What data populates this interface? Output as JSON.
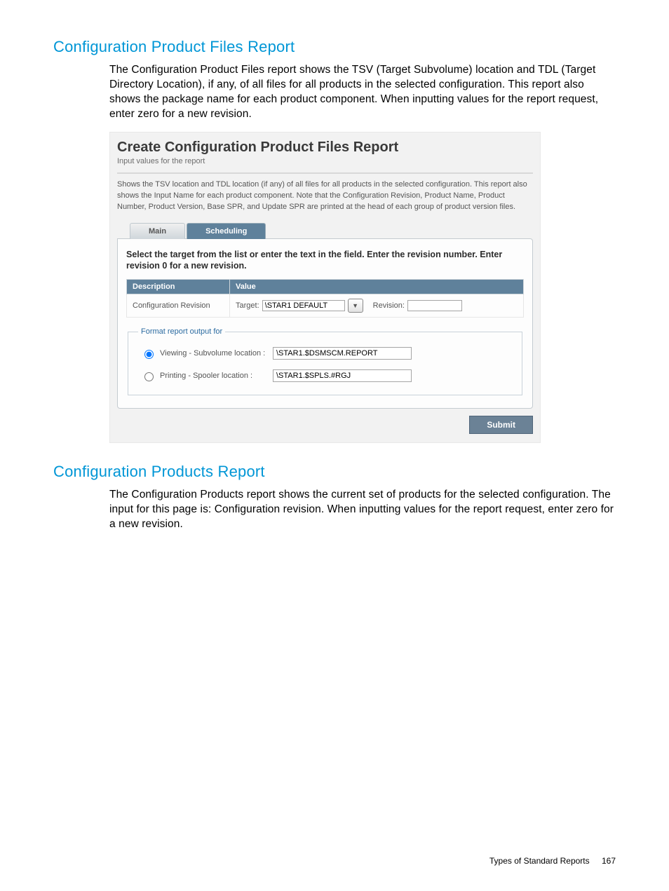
{
  "section1": {
    "heading": "Configuration Product Files Report",
    "paragraph": "The Configuration Product Files report shows the TSV (Target Subvolume) location and TDL (Target Directory Location), if any, of all files for all products in the selected configuration. This report also shows the package name for each product component. When inputting values for the report request, enter zero for a new revision."
  },
  "panel": {
    "title": "Create Configuration Product Files Report",
    "subtitle": "Input values for the report",
    "description": "Shows the TSV location and TDL location (if any) of all files for all products in the selected configuration. This report also shows the Input Name for each product component. Note that the Configuration Revision, Product Name, Product Number, Product Version, Base SPR, and Update SPR are printed at the head of each group of product version files.",
    "tabs": {
      "main": "Main",
      "scheduling": "Scheduling"
    },
    "instruction": "Select the target from the list or enter the text in the field. Enter the revision number. Enter revision 0 for a new revision.",
    "table": {
      "head_desc": "Description",
      "head_value": "Value",
      "row_desc": "Configuration Revision",
      "target_label": "Target:",
      "target_value": "\\STAR1 DEFAULT",
      "revision_label": "Revision:",
      "revision_value": ""
    },
    "format": {
      "legend": "Format report output for",
      "viewing_label": "Viewing - Subvolume location :",
      "viewing_value": "\\STAR1.$DSMSCM.REPORT",
      "printing_label": "Printing - Spooler location :",
      "printing_value": "\\STAR1.$SPLS.#RGJ"
    },
    "submit": "Submit"
  },
  "section2": {
    "heading": "Configuration Products Report",
    "paragraph": "The Configuration Products report shows the current set of products for the selected configuration. The input for this page is: Configuration revision. When inputting values for the report request, enter zero for a new revision."
  },
  "footer": {
    "label": "Types of Standard Reports",
    "page": "167"
  }
}
